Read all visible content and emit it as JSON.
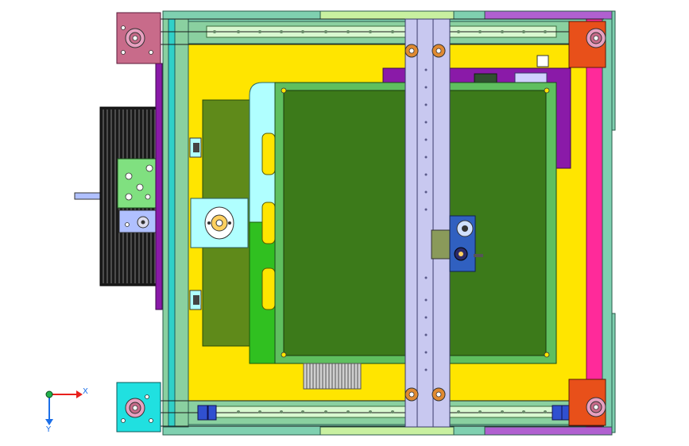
{
  "viewport": {
    "background": "#ffffff"
  },
  "triad": {
    "x_label": "X",
    "y_label": "Y",
    "x_color": "#e8201c",
    "y_color": "#1c6fe8",
    "origin_color": "#22b14c"
  },
  "colors": {
    "yellow_frame": "#ffe500",
    "green_frame": "#7fc98a",
    "cyan_rail": "#20d6c8",
    "bed": "#3c7a1a",
    "bed_border": "#5fbf5f",
    "gantry": "#c8c8f0",
    "magenta_rail": "#ff1493",
    "purple_box": "#8a1aa8",
    "corner_pink": "#c86b8a",
    "corner_cyan": "#20e0e0",
    "corner_orange": "#e8501a",
    "spool": "#2a2a2a",
    "bracket_green": "#80e080",
    "light_cyan": "#b0ffff",
    "olive_plate": "#5f8a1a",
    "bright_green": "#30c020"
  }
}
